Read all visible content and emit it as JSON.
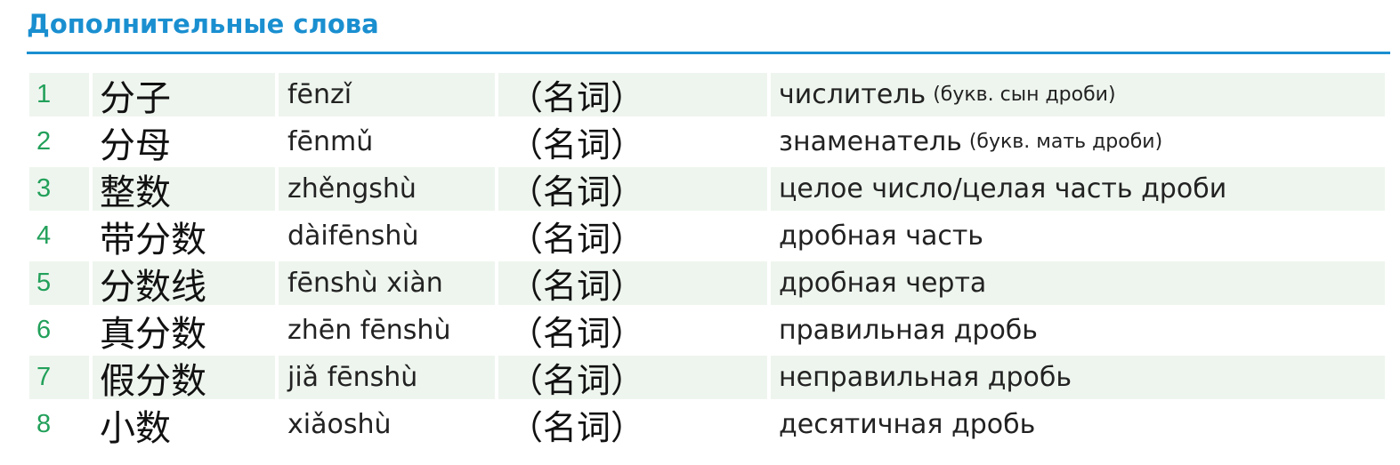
{
  "header": {
    "title": "Дополнительные слова"
  },
  "vocab": [
    {
      "num": "1",
      "hanzi": "分子",
      "pinyin": "fēnzǐ",
      "pos": "（名词）",
      "meaning": "числитель",
      "note": "(букв. сын дроби)"
    },
    {
      "num": "2",
      "hanzi": "分母",
      "pinyin": "fēnmǔ",
      "pos": "（名词）",
      "meaning": "знаменатель",
      "note": "(букв. мать дроби)"
    },
    {
      "num": "3",
      "hanzi": "整数",
      "pinyin": "zhěngshù",
      "pos": "（名词）",
      "meaning": "целое число/целая часть дроби",
      "note": ""
    },
    {
      "num": "4",
      "hanzi": "带分数",
      "pinyin": "dàifēnshù",
      "pos": "（名词）",
      "meaning": "дробная часть",
      "note": ""
    },
    {
      "num": "5",
      "hanzi": "分数线",
      "pinyin": "fēnshù xiàn",
      "pos": "（名词）",
      "meaning": "дробная черта",
      "note": ""
    },
    {
      "num": "6",
      "hanzi": "真分数",
      "pinyin": "zhēn fēnshù",
      "pos": "（名词）",
      "meaning": "правильная дробь",
      "note": ""
    },
    {
      "num": "7",
      "hanzi": "假分数",
      "pinyin": "jiǎ fēnshù",
      "pos": "（名词）",
      "meaning": "неправильная дробь",
      "note": ""
    },
    {
      "num": "8",
      "hanzi": "小数",
      "pinyin": "xiǎoshù",
      "pos": "（名词）",
      "meaning": "десятичная дробь",
      "note": ""
    }
  ]
}
